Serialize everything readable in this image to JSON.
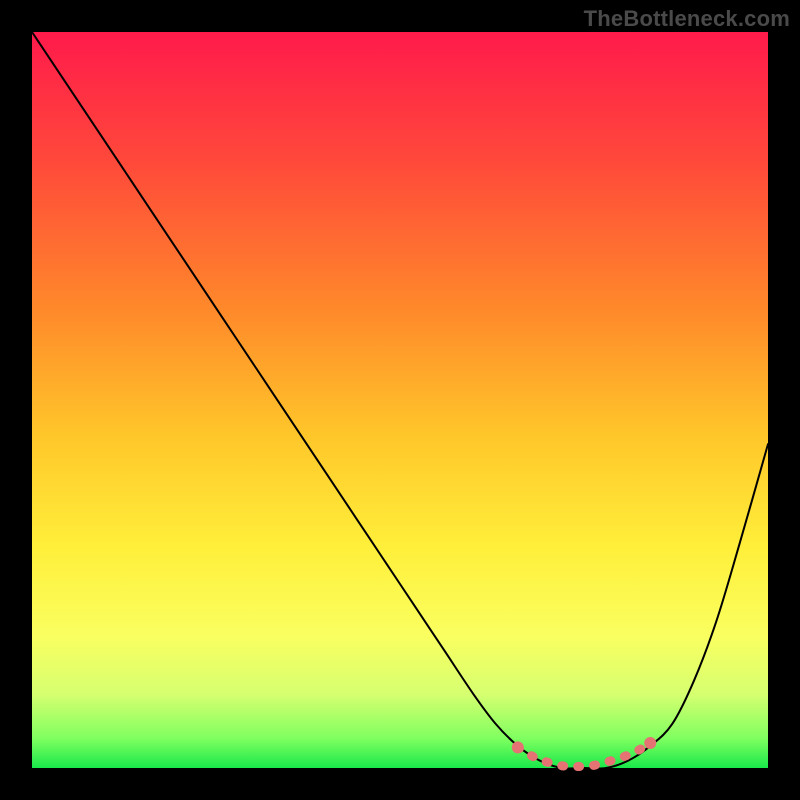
{
  "watermark": "TheBottleneck.com",
  "chart_data": {
    "type": "line",
    "title": "",
    "xlabel": "",
    "ylabel": "",
    "xlim": [
      0,
      100
    ],
    "ylim": [
      0,
      100
    ],
    "gradient_stops": [
      {
        "offset": 0,
        "color": "#ff1a4b"
      },
      {
        "offset": 18,
        "color": "#ff4a3a"
      },
      {
        "offset": 38,
        "color": "#ff8a2a"
      },
      {
        "offset": 55,
        "color": "#ffc72a"
      },
      {
        "offset": 70,
        "color": "#ffef3a"
      },
      {
        "offset": 82,
        "color": "#faff60"
      },
      {
        "offset": 90,
        "color": "#d6ff70"
      },
      {
        "offset": 96,
        "color": "#7fff60"
      },
      {
        "offset": 100,
        "color": "#19e84a"
      }
    ],
    "series": [
      {
        "name": "bottleneck-curve",
        "x": [
          0,
          4,
          8,
          12,
          16,
          20,
          24,
          28,
          32,
          36,
          40,
          44,
          48,
          52,
          56,
          60,
          63,
          66,
          69,
          72,
          75,
          78,
          81,
          84,
          87,
          90,
          93,
          96,
          100
        ],
        "y": [
          100,
          94,
          88,
          82,
          76,
          70,
          64,
          58,
          52,
          46,
          40,
          34,
          28,
          22,
          16,
          10,
          6,
          3,
          1,
          0,
          0,
          0,
          1,
          3,
          6,
          12,
          20,
          30,
          44
        ]
      }
    ],
    "highlight": {
      "name": "optimal-range",
      "color": "#e57373",
      "points_x": [
        66,
        68,
        70,
        72,
        74,
        76,
        78,
        80,
        82,
        84
      ],
      "points_y": [
        2.8,
        1.6,
        0.8,
        0.3,
        0.2,
        0.3,
        0.8,
        1.4,
        2.2,
        3.4
      ]
    }
  }
}
